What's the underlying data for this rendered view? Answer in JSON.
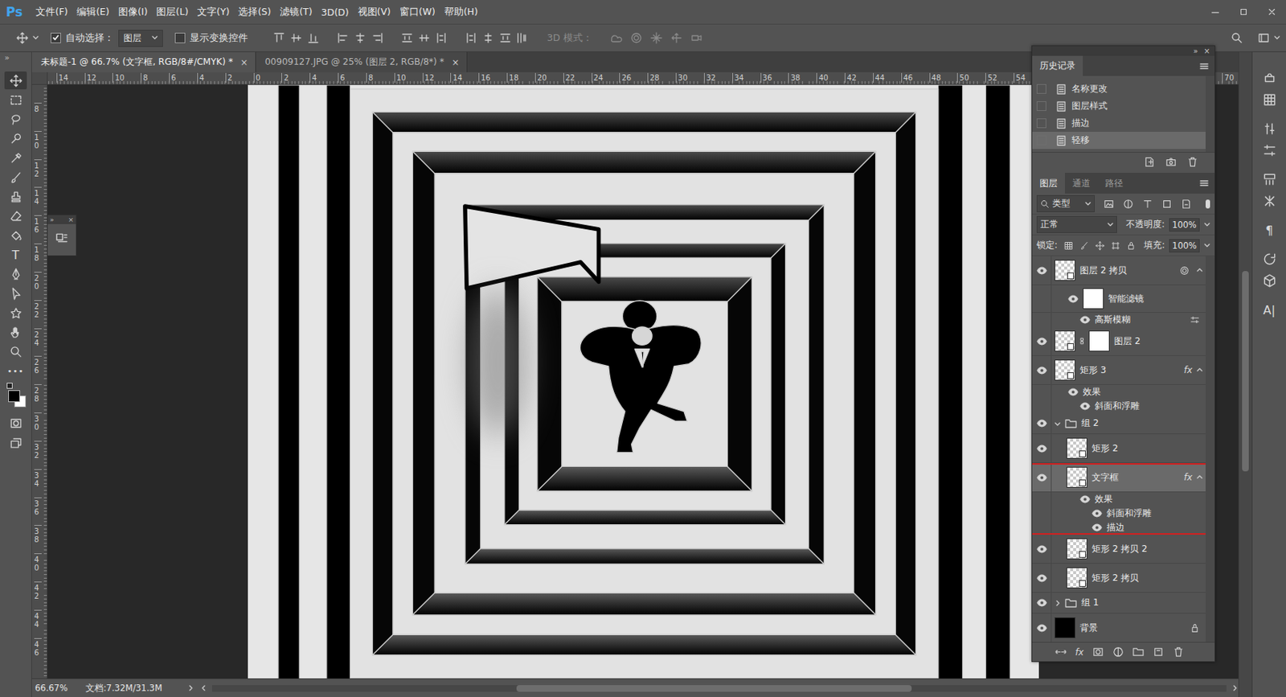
{
  "app": {
    "logo": "Ps"
  },
  "menu": [
    "文件(F)",
    "编辑(E)",
    "图像(I)",
    "图层(L)",
    "文字(Y)",
    "选择(S)",
    "滤镜(T)",
    "3D(D)",
    "视图(V)",
    "窗口(W)",
    "帮助(H)"
  ],
  "options_bar": {
    "auto_select": {
      "label": "自动选择：",
      "checked": true
    },
    "target": "图层",
    "show_transform": {
      "label": "显示变换控件",
      "checked": false
    },
    "mode_3d": {
      "label": "3D 模式：",
      "disabled": true
    }
  },
  "toolbar": {
    "collapse": "»",
    "tools": [
      {
        "kind": "icon",
        "selected": true
      },
      {
        "kind": "icon",
        "selected": false
      },
      {
        "kind": "icon",
        "selected": false
      },
      {
        "kind": "icon",
        "selected": false
      },
      {
        "kind": "icon",
        "selected": false
      },
      {
        "kind": "icon",
        "selected": false
      },
      {
        "kind": "icon",
        "selected": false
      },
      {
        "kind": "icon",
        "selected": false
      },
      {
        "kind": "icon",
        "selected": false
      },
      {
        "kind": "glyph",
        "text": "T",
        "selected": false
      },
      {
        "kind": "icon",
        "selected": false
      },
      {
        "kind": "icon",
        "selected": false
      },
      {
        "kind": "icon",
        "selected": false
      },
      {
        "kind": "icon",
        "selected": false
      },
      {
        "kind": "icon",
        "selected": false
      },
      {
        "kind": "glyph",
        "text": "•••",
        "selected": false
      }
    ],
    "colors": {
      "foreground": "#000000",
      "background": "#ffffff"
    }
  },
  "float_palette": {
    "collapse": "»",
    "close": "×"
  },
  "doc_tabs": [
    {
      "label": "未标题-1 @ 66.7% (文字框, RGB/8#/CMYK) *",
      "selected": true,
      "close": "×"
    },
    {
      "label": "00909127.JPG @ 25% (图层 2, RGB/8*) *",
      "selected": false,
      "close": "×"
    }
  ],
  "rulers": {
    "top": [
      "14",
      "12",
      "10",
      "8",
      "6",
      "4",
      "2",
      "0",
      "2",
      "4",
      "6",
      "8",
      "10",
      "12",
      "14",
      "16",
      "18",
      "20",
      "22",
      "24",
      "26",
      "28",
      "30",
      "32",
      "34",
      "36",
      "38",
      "40",
      "42",
      "44",
      "46",
      "48",
      "50",
      "52",
      "54"
    ],
    "top_far": "70",
    "left": [
      "8",
      "10",
      "12",
      "14",
      "16",
      "18",
      "20",
      "22",
      "24",
      "26",
      "28",
      "30",
      "32",
      "34",
      "36",
      "38",
      "40",
      "42",
      "44",
      "46"
    ]
  },
  "scrollbars": {
    "vertical": {
      "offset": 0.34,
      "size": 0.31
    },
    "horizontal": {
      "offset": 0.3,
      "size": 0.39
    }
  },
  "status_bar": {
    "zoom": "66.67%",
    "doc_info": "文档:7.32M/31.3M"
  },
  "panel": {
    "collapse": "»",
    "close": "×",
    "history": {
      "title": "历史记录",
      "items": [
        {
          "label": "名称更改",
          "selected": false
        },
        {
          "label": "图层样式",
          "selected": false
        },
        {
          "label": "描边",
          "selected": false
        },
        {
          "label": "轻移",
          "selected": true
        }
      ]
    },
    "layers": {
      "tabs": [
        {
          "label": "图层",
          "selected": true
        },
        {
          "label": "通道",
          "selected": false
        },
        {
          "label": "路径",
          "selected": false
        }
      ],
      "filter": "类型",
      "blend": "正常",
      "opacity_label": "不透明度:",
      "opacity": "100%",
      "lock_label": "锁定:",
      "fill_label": "填充:",
      "fill": "100%",
      "fx_button": "fx",
      "rows": [
        {
          "kind": "layer",
          "name": "图层 2 拷贝",
          "visible": true,
          "selected": false,
          "depth": 0,
          "annotated": false,
          "thumb": "checker",
          "smart": true,
          "mask": false,
          "badge": "",
          "smart_filters": true,
          "expanded": true
        },
        {
          "kind": "smart-filter",
          "name": "智能滤镜",
          "visible": true,
          "selected": false,
          "depth": 0,
          "annotated": false,
          "thumb": "white"
        },
        {
          "kind": "filter",
          "name": "高斯模糊",
          "visible": true,
          "selected": false,
          "depth": 0,
          "annotated": false
        },
        {
          "kind": "layer",
          "name": "图层 2",
          "visible": true,
          "selected": false,
          "depth": 0,
          "annotated": false,
          "thumb": "checker",
          "smart": true,
          "mask": true,
          "badge": "",
          "smart_filters": false
        },
        {
          "kind": "layer",
          "name": "矩形 3",
          "visible": true,
          "selected": false,
          "depth": 0,
          "annotated": false,
          "thumb": "checker",
          "smart": true,
          "mask": false,
          "badge": "fx",
          "smart_filters": false,
          "expanded": true
        },
        {
          "kind": "effects",
          "name": "效果",
          "visible": true,
          "selected": false,
          "depth": 0,
          "annotated": false
        },
        {
          "kind": "effect",
          "name": "斜面和浮雕",
          "visible": true,
          "selected": false,
          "depth": 0,
          "annotated": false
        },
        {
          "kind": "group",
          "name": "组 2",
          "visible": true,
          "selected": false,
          "depth": 0,
          "annotated": false,
          "expanded": true
        },
        {
          "kind": "layer",
          "name": "矩形 2",
          "visible": true,
          "selected": false,
          "depth": 1,
          "annotated": false,
          "thumb": "checker",
          "smart": true,
          "mask": false,
          "badge": "",
          "smart_filters": false
        },
        {
          "kind": "layer",
          "name": "文字框",
          "visible": true,
          "selected": true,
          "depth": 1,
          "annotated": true,
          "thumb": "checker",
          "smart": true,
          "mask": false,
          "badge": "fx",
          "smart_filters": false,
          "expanded": true
        },
        {
          "kind": "effects",
          "name": "效果",
          "visible": true,
          "selected": false,
          "depth": 1,
          "annotated": true
        },
        {
          "kind": "effect",
          "name": "斜面和浮雕",
          "visible": true,
          "selected": false,
          "depth": 1,
          "annotated": true
        },
        {
          "kind": "effect",
          "name": "描边",
          "visible": true,
          "selected": false,
          "depth": 1,
          "annotated": true
        },
        {
          "kind": "layer",
          "name": "矩形 2 拷贝 2",
          "visible": true,
          "selected": false,
          "depth": 1,
          "annotated": false,
          "thumb": "checker",
          "smart": true,
          "mask": false,
          "badge": "",
          "smart_filters": false
        },
        {
          "kind": "layer",
          "name": "矩形 2 拷贝",
          "visible": true,
          "selected": false,
          "depth": 1,
          "annotated": false,
          "thumb": "checker",
          "smart": true,
          "mask": false,
          "badge": "",
          "smart_filters": false
        },
        {
          "kind": "group",
          "name": "组 1",
          "visible": true,
          "selected": false,
          "depth": 0,
          "annotated": false,
          "expanded": false
        },
        {
          "kind": "background",
          "name": "背景",
          "visible": true,
          "selected": false,
          "depth": 0,
          "annotated": false,
          "thumb": "black",
          "locked": true
        }
      ]
    }
  },
  "right_strip": {
    "items": [
      {
        "kind": "icon"
      },
      {
        "kind": "icon"
      },
      {
        "kind": "icon"
      },
      {
        "kind": "icon"
      },
      {
        "kind": "icon"
      },
      {
        "kind": "icon"
      },
      {
        "kind": "glyph",
        "text": "¶"
      },
      {
        "kind": "icon"
      },
      {
        "kind": "icon"
      },
      {
        "kind": "glyph",
        "text": "A|"
      }
    ]
  }
}
